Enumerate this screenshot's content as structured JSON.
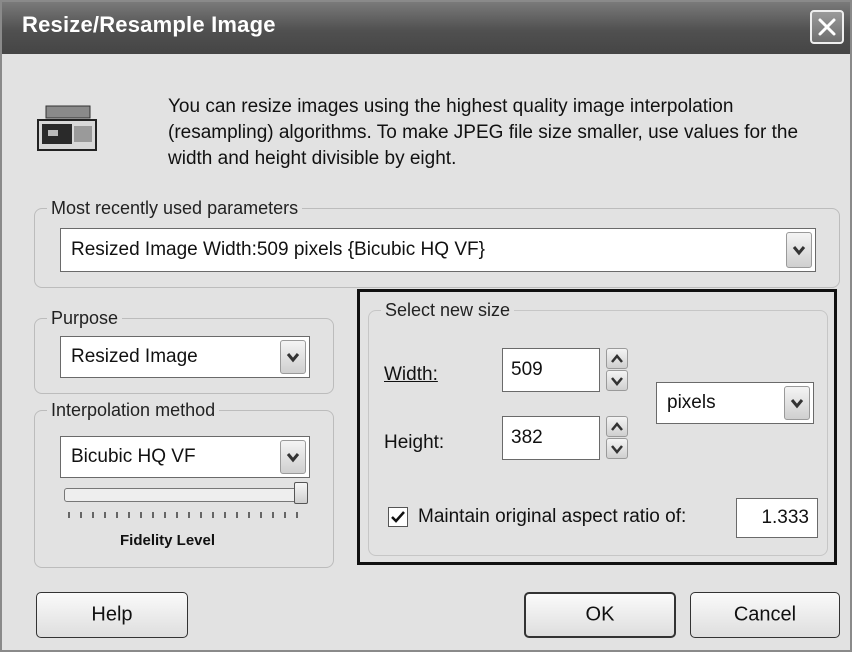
{
  "window": {
    "title": "Resize/Resample Image",
    "close_icon": "close-icon"
  },
  "intro": {
    "text": "You can resize images using the highest quality image interpolation (resampling) algorithms.   To make JPEG file size smaller, use values for the width and height divisible by eight.",
    "icon": "resize-image-icon"
  },
  "recent": {
    "legend": "Most recently used parameters",
    "value": "Resized Image Width:509 pixels {Bicubic HQ VF}"
  },
  "purpose": {
    "legend": "Purpose",
    "value": "Resized Image"
  },
  "interpolation": {
    "legend": "Interpolation method",
    "value": "Bicubic HQ VF",
    "fidelity_label": "Fidelity Level",
    "fidelity_level": 1.0
  },
  "size": {
    "legend": "Select new size",
    "width_label": "Width:",
    "width_value": "509",
    "height_label": "Height:",
    "height_value": "382",
    "unit": "pixels",
    "aspect_checked": true,
    "aspect_label": "Maintain original aspect ratio of:",
    "aspect_value": "1.333"
  },
  "buttons": {
    "help": "Help",
    "ok": "OK",
    "cancel": "Cancel"
  },
  "colors": {
    "titlebar": "#505050",
    "dialog_bg": "#e2e2e2"
  }
}
